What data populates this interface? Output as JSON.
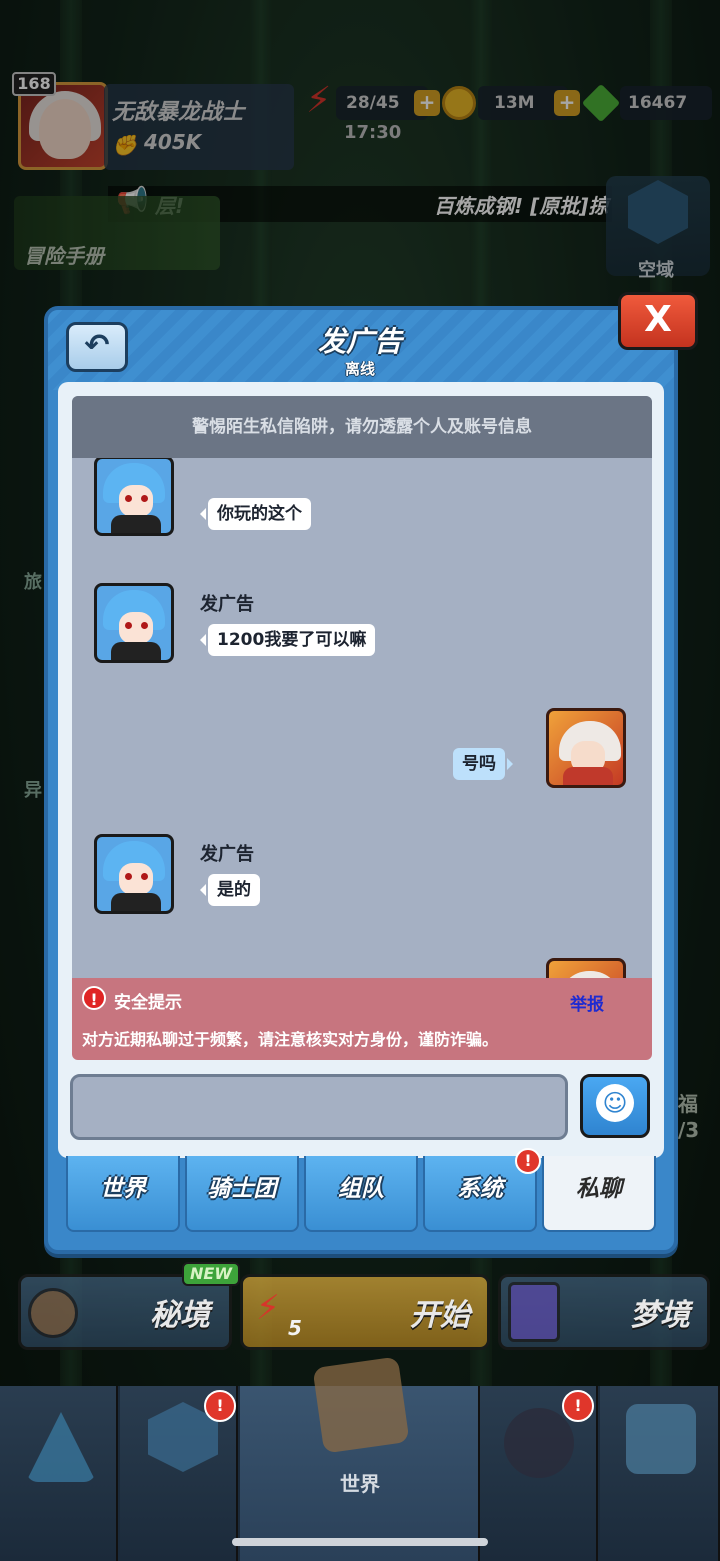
{
  "hud": {
    "level": "168",
    "player_name": "无敌暴龙战士",
    "power": "405K",
    "energy": "28/45",
    "timer": "17:30",
    "coins": "13M",
    "gems": "16467",
    "plus": "+"
  },
  "marquee": {
    "left_text": "层!",
    "right_text": "百炼成钢! [原批]掠"
  },
  "side": {
    "adventure_handbook": "冒险手册",
    "kongyu": "空域",
    "left_a": "旅",
    "left_b": "异",
    "right_a": "福",
    "right_b": "/3"
  },
  "dialog": {
    "title": "发广告",
    "status": "离线",
    "back": "↶",
    "close": "X",
    "top_warning": "警惕陌生私信陷阱，请勿透露个人及账号信息"
  },
  "messages": [
    {
      "sender": "发广告",
      "text": "你玩的这个",
      "side": "left"
    },
    {
      "sender": "发广告",
      "text": "1200我要了可以嘛",
      "side": "left"
    },
    {
      "sender": "",
      "text": "号吗",
      "side": "right"
    },
    {
      "sender": "发广告",
      "text": "是的",
      "side": "left"
    }
  ],
  "safety": {
    "icon": "!",
    "title": "安全提示",
    "report": "举报",
    "text": "对方近期私聊过于频繁，请注意核实对方身份，谨防诈骗。"
  },
  "input": {
    "value": "",
    "emoji": "☺"
  },
  "tabs": [
    {
      "label": "世界",
      "active": false
    },
    {
      "label": "骑士团",
      "active": false
    },
    {
      "label": "组队",
      "active": false
    },
    {
      "label": "系统",
      "active": false,
      "badge": "!"
    },
    {
      "label": "私聊",
      "active": true
    }
  ],
  "bottom_buttons": {
    "secret": "秘境",
    "new_badge": "NEW",
    "start": "开始",
    "energy_cost": "5",
    "dream": "梦境"
  },
  "nav": {
    "active_label": "世界",
    "badge": "!"
  },
  "colors": {
    "dialog_blue": "#3a87c9",
    "chat_bg": "#a5b0c3",
    "safety_red": "#c7757f",
    "close_red": "#e0452e",
    "report_blue": "#1e2ad1"
  }
}
